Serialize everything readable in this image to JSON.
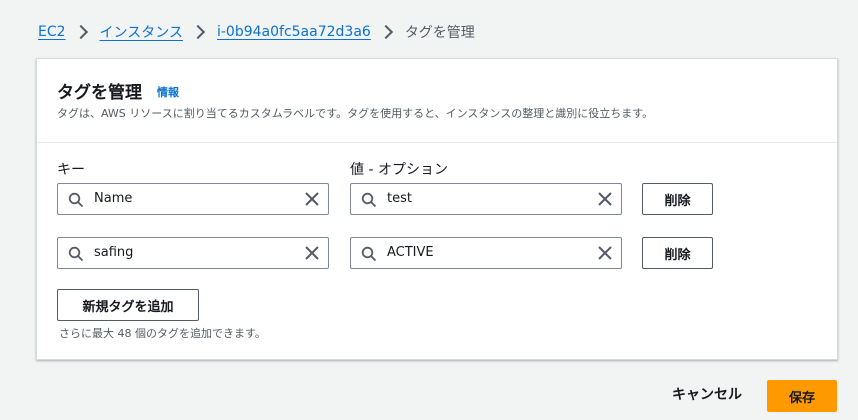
{
  "breadcrumb": {
    "items": [
      "EC2",
      "インスタンス",
      "i-0b94a0fc5aa72d3a6"
    ],
    "current": "タグを管理"
  },
  "panel": {
    "title": "タグを管理",
    "info": "情報",
    "description": "タグは、AWS リソースに割り当てるカスタムラベルです。タグを使用すると、インスタンスの整理と識別に役立ちます。"
  },
  "columns": {
    "key": "キー",
    "value": "値 - オプション"
  },
  "tags": [
    {
      "key": "Name",
      "value": "test",
      "remove": "削除"
    },
    {
      "key": "safing",
      "value": "ACTIVE",
      "remove": "削除"
    }
  ],
  "add_button": "新規タグを追加",
  "hint": "さらに最大 48 個のタグを追加できます。",
  "footer": {
    "cancel": "キャンセル",
    "save": "保存"
  },
  "icons": {
    "search": "search-icon",
    "clear": "close-icon",
    "separator": "chevron-right-icon"
  },
  "colors": {
    "primary": "#ff9900",
    "link": "#0972d3"
  }
}
